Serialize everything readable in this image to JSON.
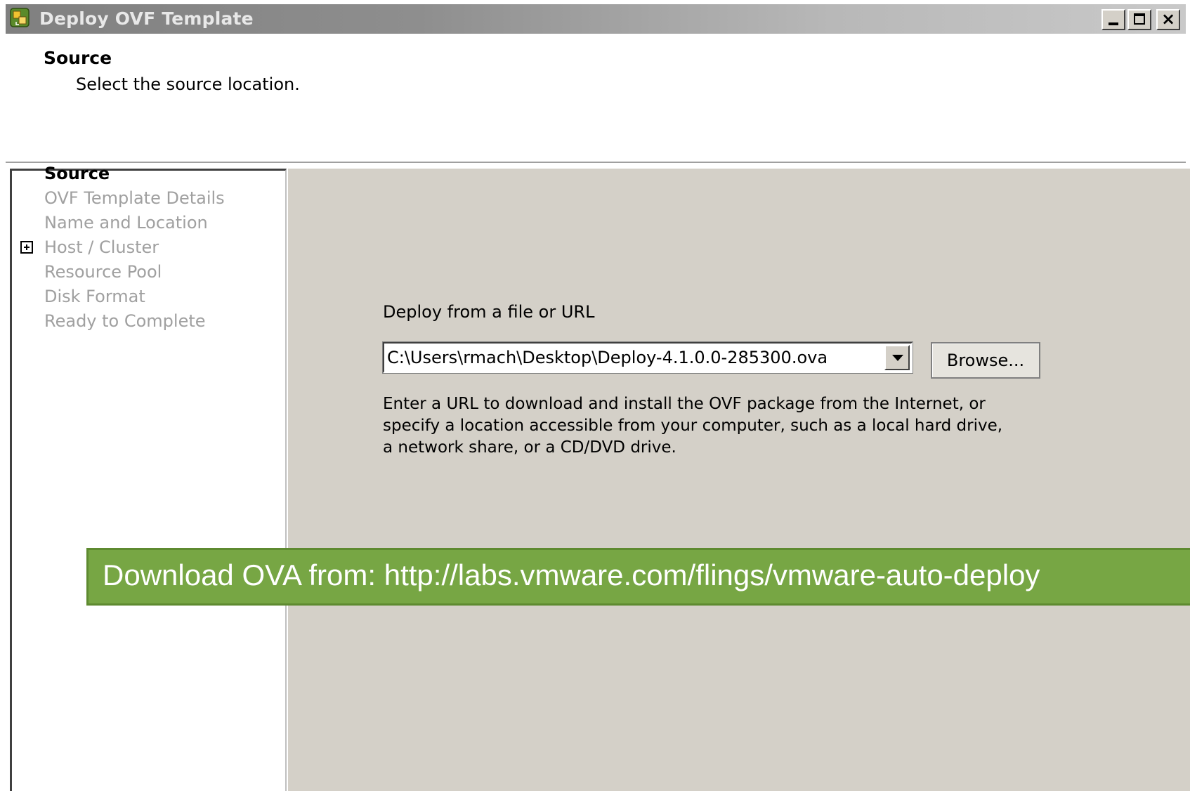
{
  "window": {
    "title": "Deploy OVF Template",
    "icon": "ovf-deploy-icon"
  },
  "header": {
    "title": "Source",
    "subtitle": "Select the source location."
  },
  "steps": [
    {
      "label": "Source",
      "state": "active"
    },
    {
      "label": "OVF Template Details",
      "state": "disabled"
    },
    {
      "label": "Name and Location",
      "state": "disabled"
    },
    {
      "label": "Host / Cluster",
      "state": "disabled",
      "expandable": true
    },
    {
      "label": "Resource Pool",
      "state": "disabled"
    },
    {
      "label": "Disk Format",
      "state": "disabled"
    },
    {
      "label": "Ready to Complete",
      "state": "disabled"
    }
  ],
  "source": {
    "label": "Deploy from a file or URL",
    "path_value": "C:\\Users\\rmach\\Desktop\\Deploy-4.1.0.0-285300.ova",
    "browse_label": "Browse...",
    "help": "Enter a URL to download and install the OVF package from the Internet, or specify a location accessible from your computer, such as a local hard drive, a network share, or a CD/DVD drive."
  },
  "banner": {
    "text": "Download OVA from: http://labs.vmware.com/flings/vmware-auto-deploy"
  },
  "colors": {
    "dialog_bg": "#d4d0c8",
    "banner_bg": "#77a644",
    "disabled_text": "#a0a0a0"
  }
}
